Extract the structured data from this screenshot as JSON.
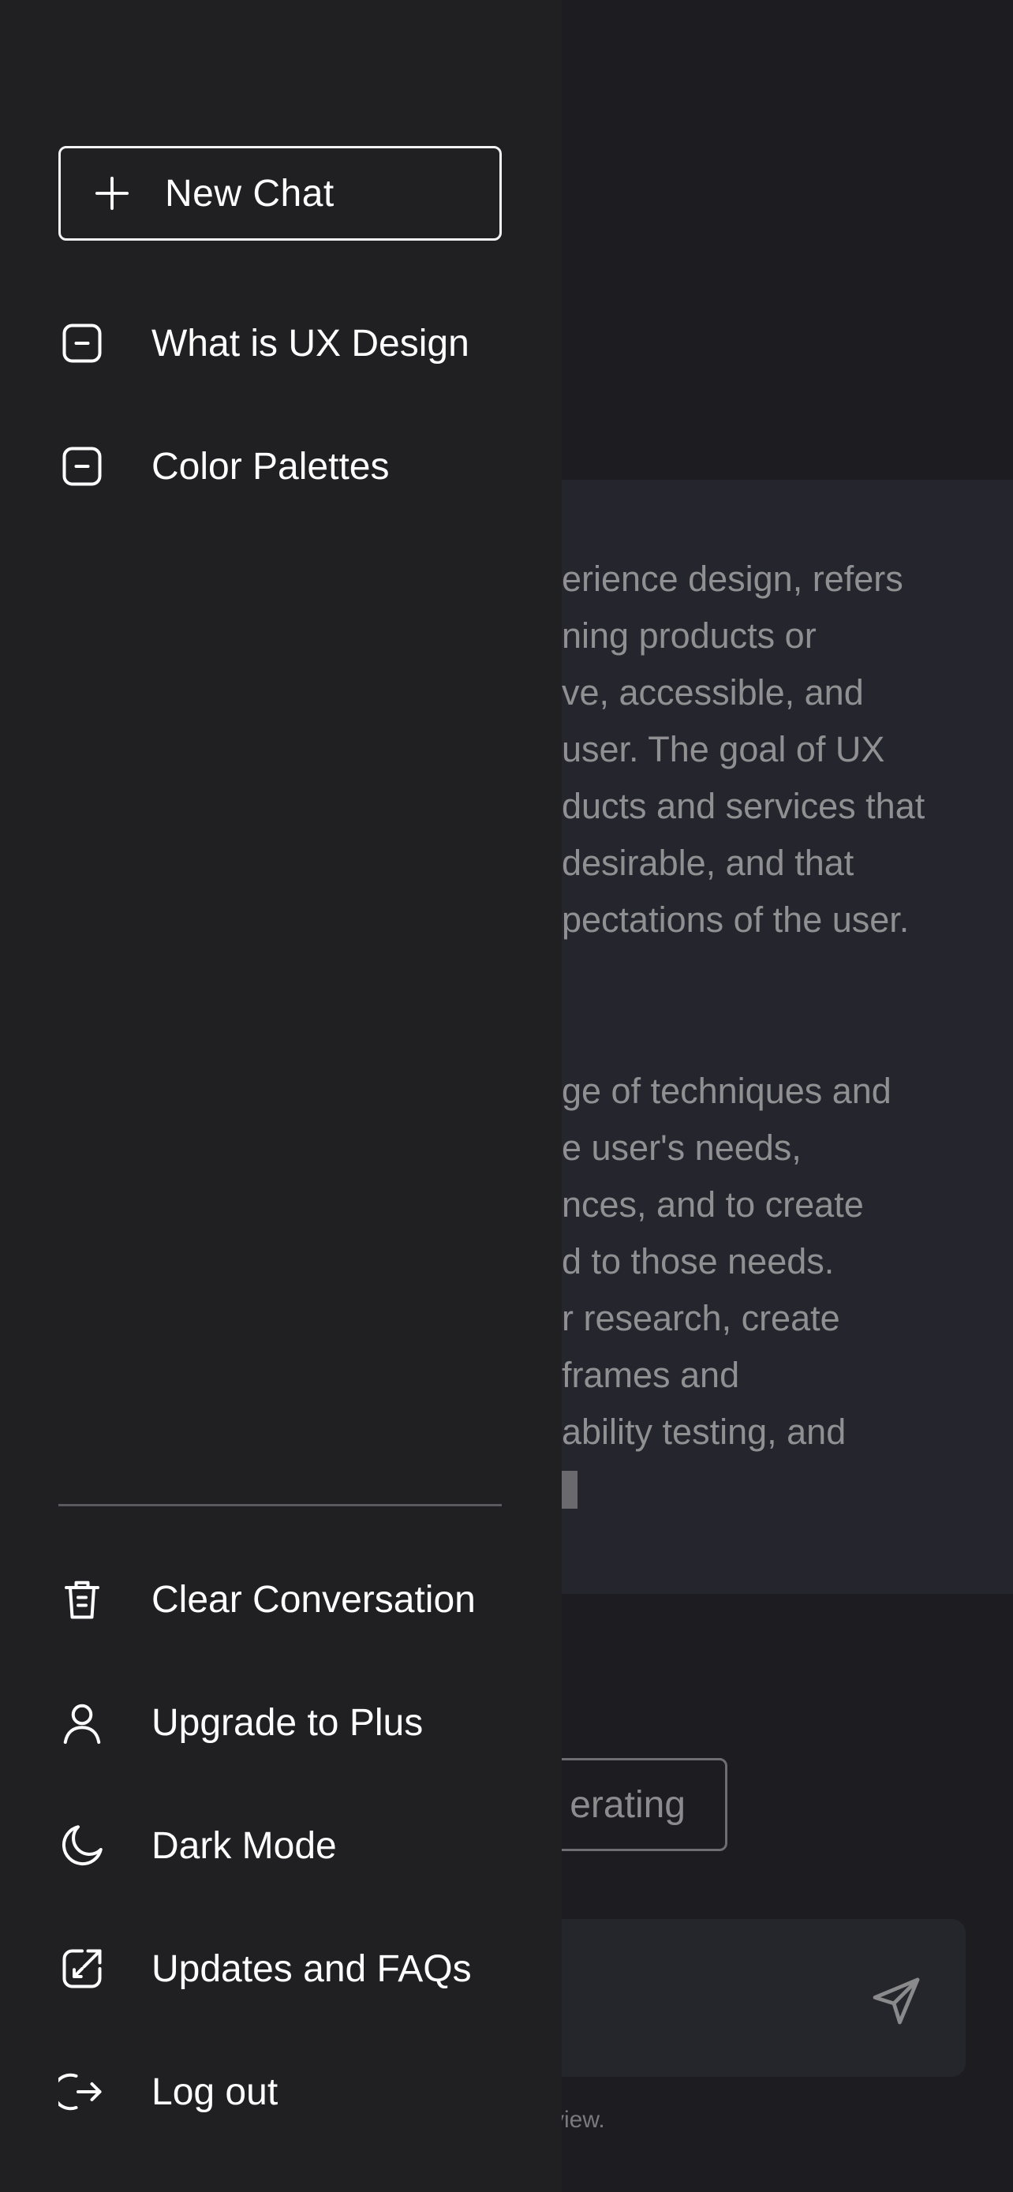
{
  "drawer": {
    "new_chat_label": "New Chat",
    "history": [
      {
        "label": "What is UX Design",
        "icon": "message-square-icon"
      },
      {
        "label": "Color Palettes",
        "icon": "message-square-icon"
      }
    ],
    "actions": [
      {
        "label": "Clear Conversation",
        "icon": "trash-icon"
      },
      {
        "label": "Upgrade to Plus",
        "icon": "user-icon"
      },
      {
        "label": "Dark Mode",
        "icon": "moon-icon"
      },
      {
        "label": "Updates and FAQs",
        "icon": "external-link-icon"
      },
      {
        "label": "Log out",
        "icon": "logout-icon"
      }
    ]
  },
  "main": {
    "answer_lines": [
      "erience design, refers",
      "ning products or",
      "ve, accessible, and",
      " user. The goal of UX",
      "ducts and services that",
      "desirable, and that",
      "pectations of the user.",
      "ge of techniques and",
      "e user's needs,",
      "nces, and to create",
      "d to those needs.",
      "r research, create",
      "frames and",
      "ability testing, and"
    ],
    "stop_button_label": "erating",
    "disclaimer": "view."
  },
  "colors": {
    "drawer_bg": "#202023",
    "main_bg": "#1c1c21",
    "panel_bg": "#25252d",
    "text": "#ffffff",
    "muted_text": "#909093"
  }
}
